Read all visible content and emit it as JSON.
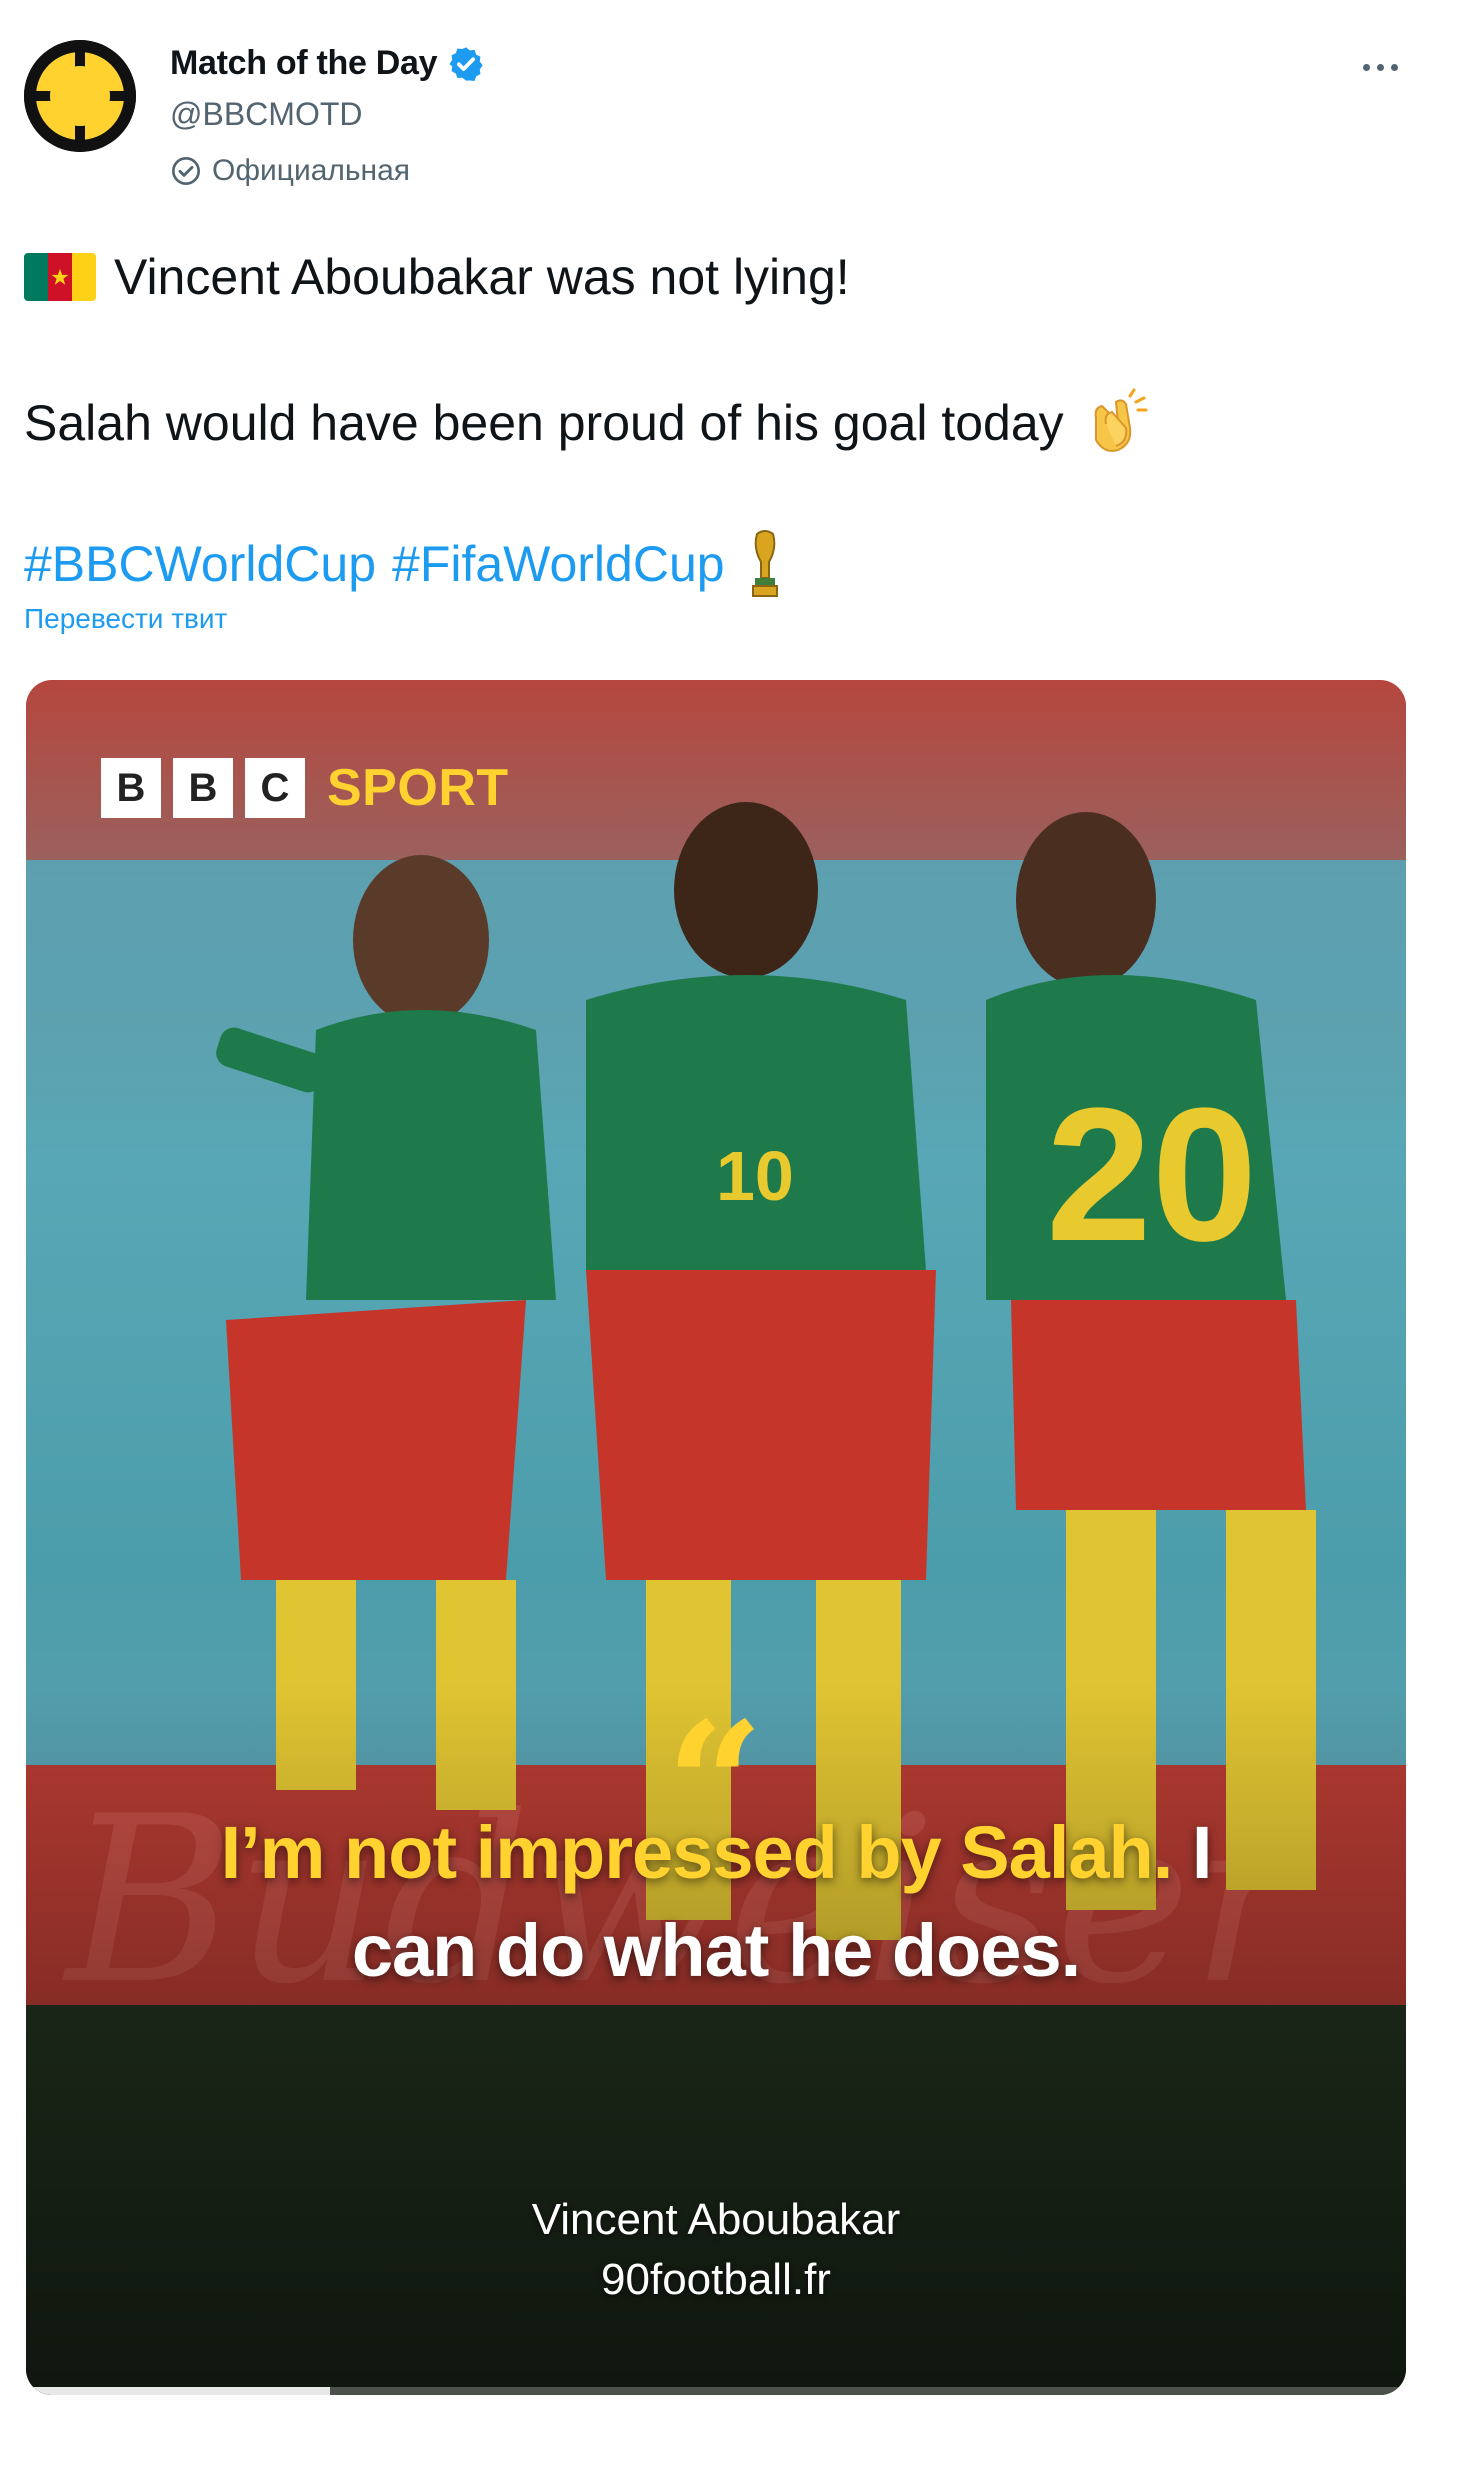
{
  "author": {
    "display_name": "Match of the Day",
    "handle": "@BBCMOTD",
    "official_label": "Официальная",
    "verified": true
  },
  "tweet": {
    "line1": "Vincent Aboubakar was not lying!",
    "line2": "Salah would have been proud of his goal today",
    "hashtags": [
      "#BBCWorldCup",
      "#FifaWorldCup"
    ],
    "translate_label": "Перевести твит"
  },
  "icons": {
    "flag": "cameroon-flag-icon",
    "clap": "clapping-hands-icon",
    "trophy": "trophy-icon",
    "more": "more-icon",
    "verified": "verified-badge-icon",
    "official": "official-icon"
  },
  "media": {
    "brand_letters": [
      "B",
      "B",
      "C"
    ],
    "brand_word": "SPORT",
    "quote_yellow": "I’m not impressed by Salah.",
    "quote_white_tail": " I",
    "quote_line2": "can do what he does.",
    "attribution_name": "Vincent Aboubakar",
    "attribution_source": "90football.fr",
    "video_progress": 0.22
  },
  "colors": {
    "link": "#1d9bf0",
    "brand_yellow": "#ffd230",
    "secondary_text": "#536471",
    "flag": [
      "#007a5e",
      "#ce1126",
      "#fcd116"
    ]
  }
}
